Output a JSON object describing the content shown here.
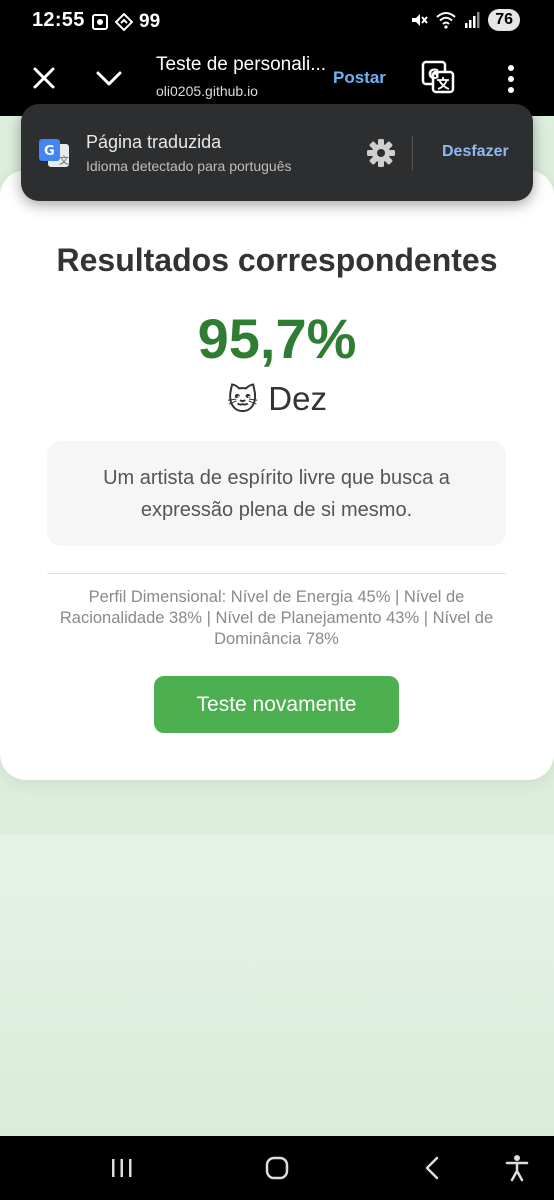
{
  "status": {
    "time": "12:55",
    "notif_count": "99",
    "battery": "76"
  },
  "toolbar": {
    "title": "Teste de personali...",
    "url": "oli0205.github.io",
    "post_label": "Postar"
  },
  "translate_popup": {
    "title": "Página traduzida",
    "subtitle": "Idioma detectado para português",
    "undo_label": "Desfazer"
  },
  "result": {
    "heading": "Resultados correspondentes",
    "percent": "95,7%",
    "type_emoji": "🐱",
    "type_name": "Dez",
    "description": "Um artista de espírito livre que busca a expressão plena de si mesmo.",
    "profile": "Perfil Dimensional: Nível de Energia 45% | Nível de Racionalidade 38% | Nível de Planejamento 43% | Nível de Dominância 78%",
    "retry_label": "Teste novamente"
  },
  "colors": {
    "accent_green": "#2e7d32",
    "button_green": "#4caf50",
    "link_blue": "#6cb4f7"
  },
  "icons": [
    "close-icon",
    "chevron-down-icon",
    "translate-icon",
    "more-vert-icon",
    "google-translate-logo",
    "gear-icon",
    "recent-apps-icon",
    "home-icon",
    "back-icon",
    "accessibility-icon"
  ]
}
